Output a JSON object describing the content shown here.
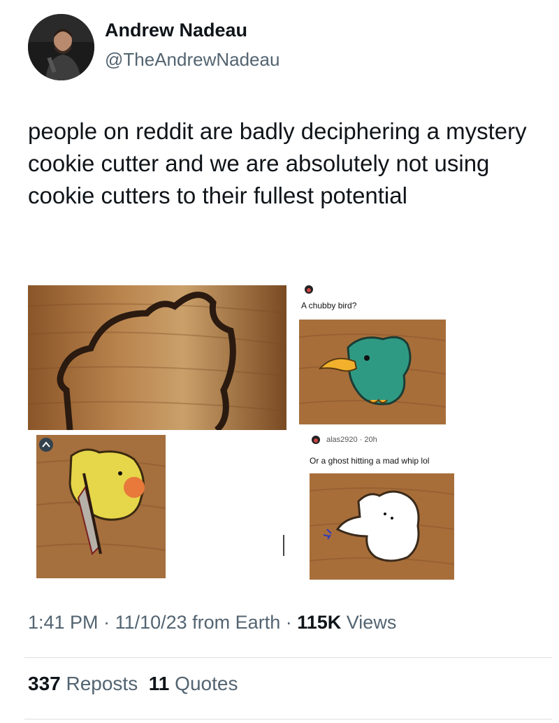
{
  "author": {
    "name": "Andrew Nadeau",
    "handle": "@TheAndrewNadeau"
  },
  "tweet": {
    "text": "people on reddit are badly deciphering a mystery cookie cutter and we are absolutely not using cookie cutters to their fullest potential"
  },
  "embedded_comments": [
    {
      "username": "",
      "text": "A chubby bird?"
    },
    {
      "username": "alas2920 · 20h",
      "text": "Or a ghost hitting a mad whip lol"
    }
  ],
  "meta": {
    "time": "1:41 PM",
    "sep1": " · ",
    "date": "11/10/23",
    "source": " from Earth",
    "sep2": " · ",
    "views_count": "115K",
    "views_label": " Views"
  },
  "stats": {
    "reposts_count": "337",
    "reposts_label": " Reposts",
    "quotes_count": "11",
    "quotes_label": " Quotes"
  },
  "colors": {
    "text": "#0f1419",
    "secondary": "#536471",
    "wood": "#a86e3a",
    "bird_teal": "#2f9a84",
    "duck_yellow": "#e6d64a"
  }
}
